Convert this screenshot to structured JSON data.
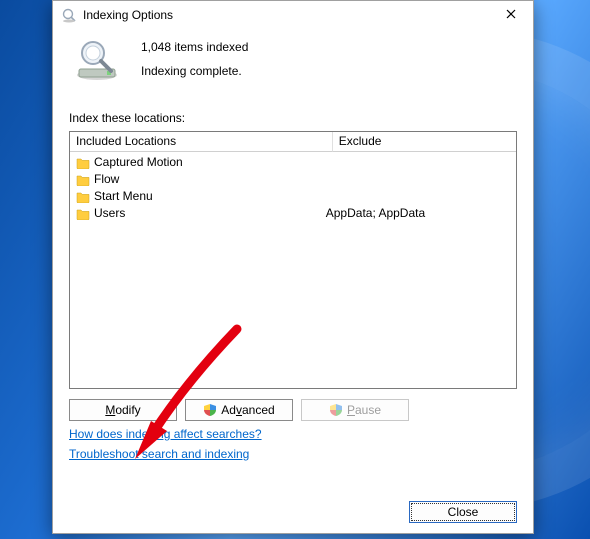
{
  "dialog": {
    "title": "Indexing Options",
    "status_count": "1,048 items indexed",
    "status_state": "Indexing complete.",
    "section_label": "Index these locations:",
    "col_included": "Included Locations",
    "col_exclude": "Exclude",
    "items": [
      {
        "name": "Captured Motion",
        "exclude": ""
      },
      {
        "name": "Flow",
        "exclude": ""
      },
      {
        "name": "Start Menu",
        "exclude": ""
      },
      {
        "name": "Users",
        "exclude": "AppData; AppData"
      }
    ],
    "buttons": {
      "modify": {
        "pre": "",
        "key": "M",
        "post": "odify"
      },
      "advanced": {
        "pre": "Ad",
        "key": "v",
        "post": "anced"
      },
      "pause": {
        "pre": "",
        "key": "P",
        "post": "ause"
      }
    },
    "links": {
      "how": "How does indexing affect searches?",
      "troub": "Troubleshoot search and indexing"
    },
    "close_label": "Close"
  },
  "colors": {
    "folder": "#ffcd3f",
    "link": "#0066cc",
    "arrow": "#e3000f"
  }
}
